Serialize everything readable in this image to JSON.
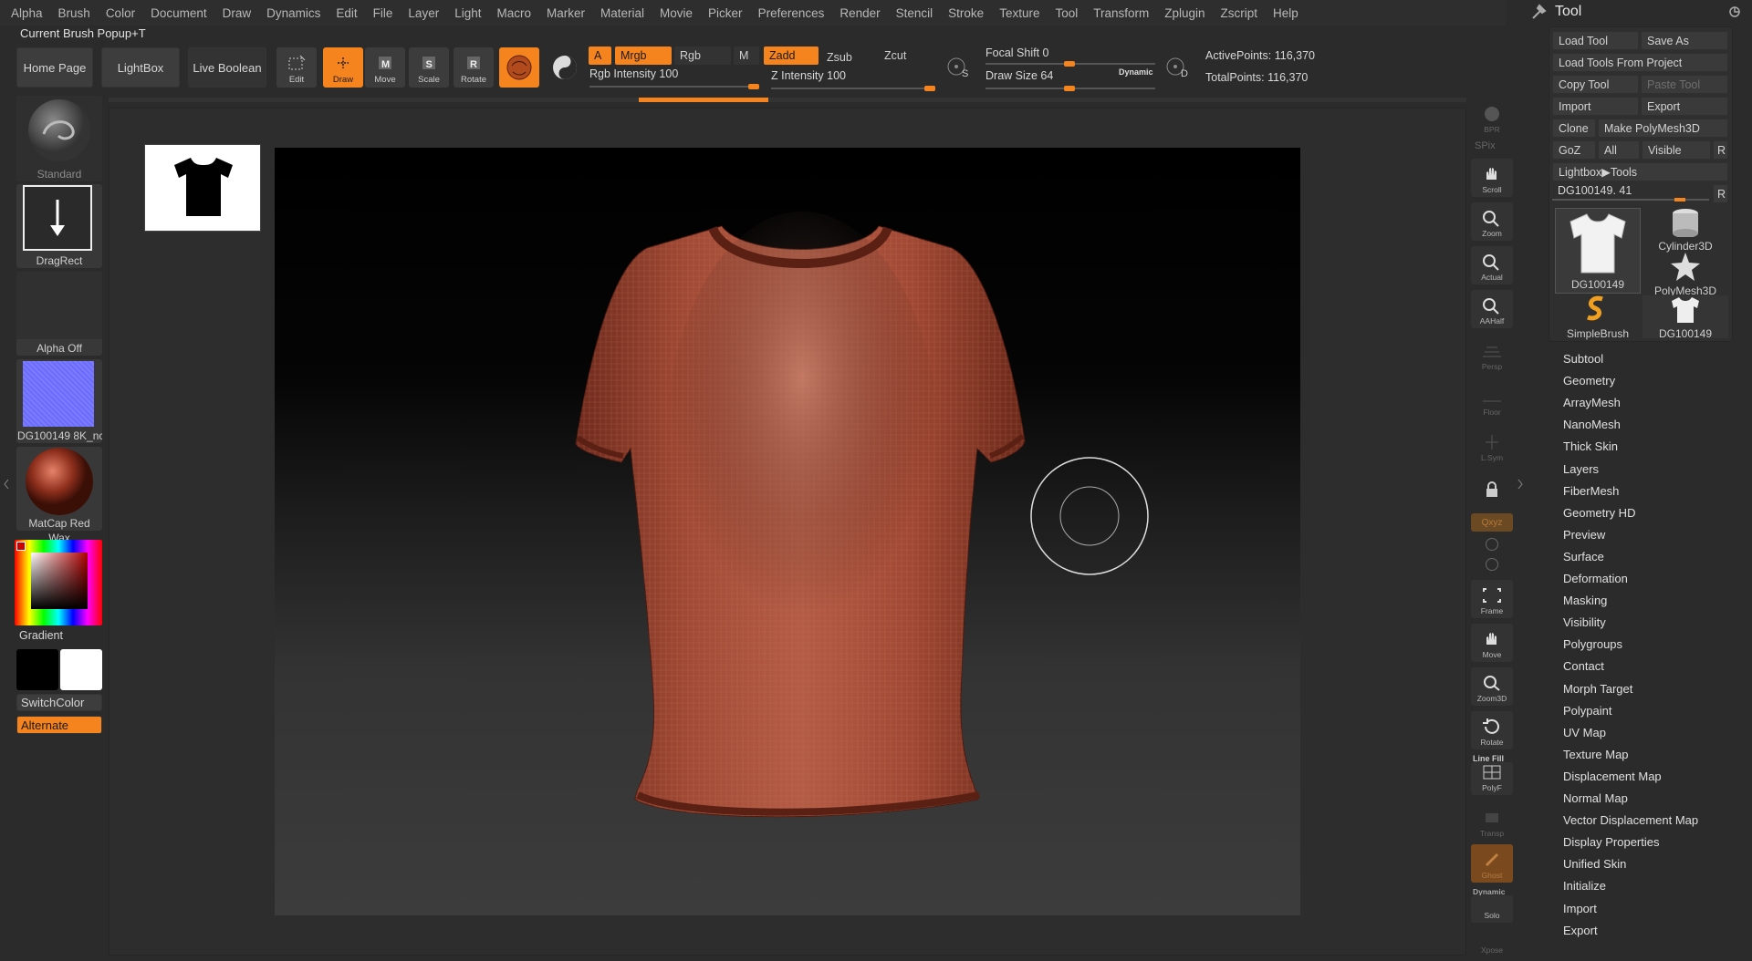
{
  "menu": [
    "Alpha",
    "Brush",
    "Color",
    "Document",
    "Draw",
    "Dynamics",
    "Edit",
    "File",
    "Layer",
    "Light",
    "Macro",
    "Marker",
    "Material",
    "Movie",
    "Picker",
    "Preferences",
    "Render",
    "Stencil",
    "Stroke",
    "Texture",
    "Tool",
    "Transform",
    "Zplugin",
    "Zscript",
    "Help"
  ],
  "current_brush_popup": "Current Brush Popup+T",
  "shelf": {
    "home_page": "Home Page",
    "lightbox": "LightBox",
    "live_boolean": "Live Boolean",
    "edit": "Edit",
    "draw": "Draw",
    "move": "Move",
    "scale": "Scale",
    "rotate": "Rotate",
    "a": "A",
    "mrgb": "Mrgb",
    "rgb": "Rgb",
    "m": "M",
    "zadd": "Zadd",
    "zsub": "Zsub",
    "zcut": "Zcut",
    "rgb_intensity": "Rgb Intensity 100",
    "z_intensity": "Z Intensity 100",
    "focal_shift": "Focal Shift 0",
    "draw_size": "Draw Size 64",
    "dynamic": "Dynamic",
    "s_key": "S",
    "d_key": "D",
    "active_points": "ActivePoints: 116,370",
    "total_points": "TotalPoints: 116,370"
  },
  "left": {
    "brush": "Standard",
    "stroke": "DragRect",
    "alpha": "Alpha Off",
    "texture": "DG100149 8K_nc",
    "material": "MatCap Red Wax",
    "gradient": "Gradient",
    "switch_color": "SwitchColor",
    "alternate": "Alternate"
  },
  "right_shelf": {
    "bpr": "BPR",
    "spix": "SPix",
    "scroll": "Scroll",
    "zoom": "Zoom",
    "actual": "Actual",
    "aahalf": "AAHalf",
    "persp": "Persp",
    "floor": "Floor",
    "lsym": "L.Sym",
    "xyz": "Qxyz",
    "frame": "Frame",
    "move": "Move",
    "zoom3d": "Zoom3D",
    "rotate": "Rotate",
    "line_fill": "Line Fill",
    "polyf": "PolyF",
    "transp": "Transp",
    "ghost": "Ghost",
    "dynamic": "Dynamic",
    "solo": "Solo",
    "xpose": "Xpose"
  },
  "tool": {
    "title": "Tool",
    "load_tool": "Load Tool",
    "save_as": "Save As",
    "load_from_project": "Load Tools From Project",
    "copy_tool": "Copy Tool",
    "paste_tool": "Paste Tool",
    "import": "Import",
    "export": "Export",
    "clone": "Clone",
    "make_polymesh": "Make PolyMesh3D",
    "goz": "GoZ",
    "all": "All",
    "visible": "Visible",
    "r": "R",
    "lightbox_tools": "Lightbox▶Tools",
    "current": "DG100149. 41",
    "r2": "R",
    "tiles": [
      "DG100149",
      "Cylinder3D",
      "PolyMesh3D",
      "SimpleBrush",
      "DG100149"
    ],
    "sections": [
      "Subtool",
      "Geometry",
      "ArrayMesh",
      "NanoMesh",
      "Thick Skin",
      "Layers",
      "FiberMesh",
      "Geometry HD",
      "Preview",
      "Surface",
      "Deformation",
      "Masking",
      "Visibility",
      "Polygroups",
      "Contact",
      "Morph Target",
      "Polypaint",
      "UV Map",
      "Texture Map",
      "Displacement Map",
      "Normal Map",
      "Vector Displacement Map",
      "Display Properties",
      "Unified Skin",
      "Initialize",
      "Import",
      "Export"
    ]
  },
  "colors": {
    "accent": "#f5841f",
    "shirt": "#9a3f2c"
  }
}
